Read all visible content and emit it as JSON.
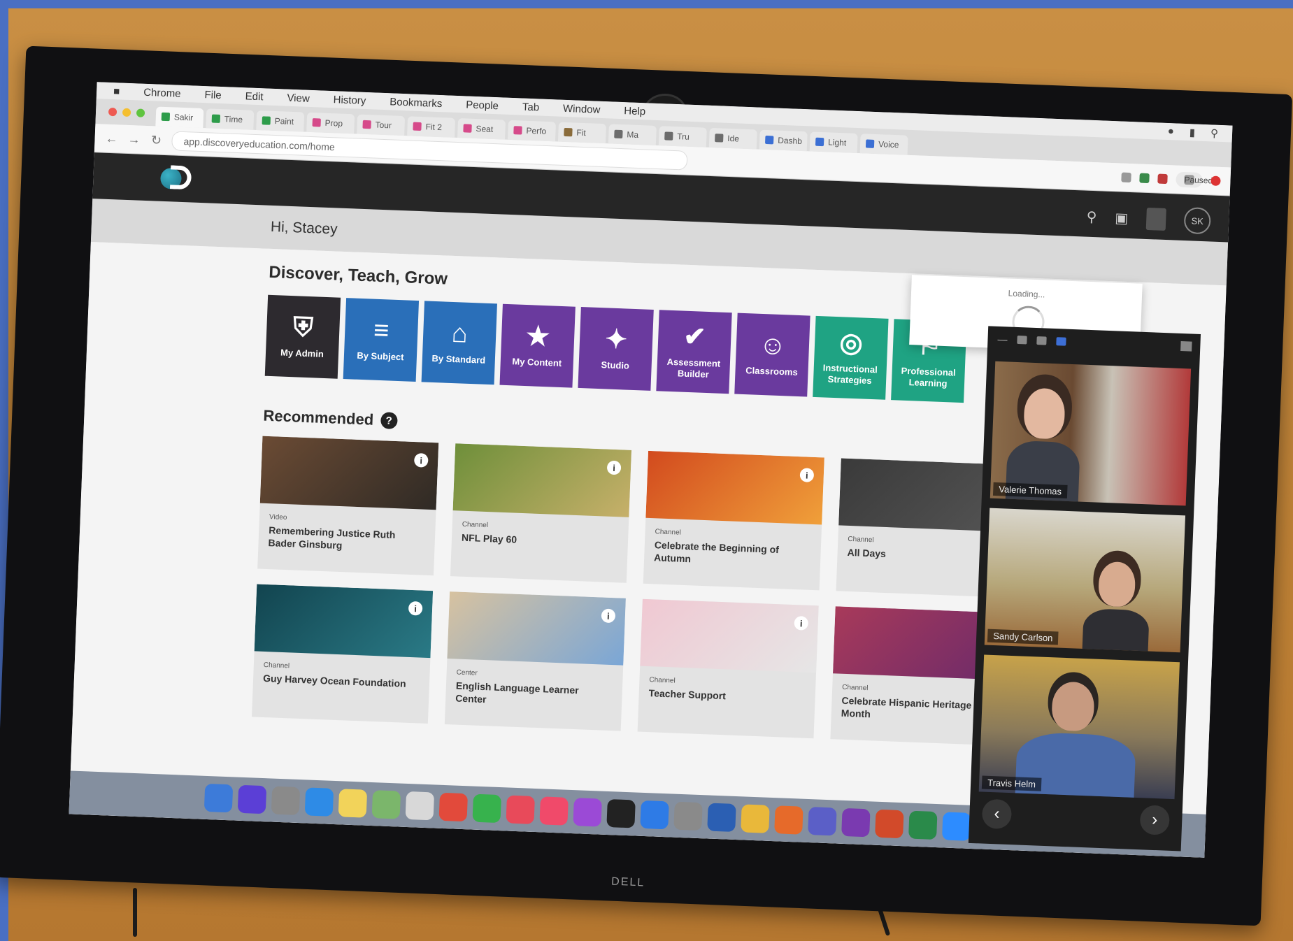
{
  "browser": {
    "menu": [
      "Chrome",
      "File",
      "Edit",
      "View",
      "History",
      "Bookmarks",
      "People",
      "Tab",
      "Window",
      "Help"
    ],
    "tabs": [
      "Sakir",
      "Time",
      "Paint",
      "Prop",
      "Tour",
      "Fit 2",
      "Seat",
      "Perfo",
      "Fit",
      "Ma",
      "Tru",
      "Ide",
      "Dashb",
      "Light",
      "Voice"
    ],
    "url": "app.discoveryeducation.com/home",
    "profile_label": "Paused",
    "colors": {
      "tab_favicons": [
        "#2d9c4a",
        "#2d9c4a",
        "#2d9c4a",
        "#d64a8a",
        "#d64a8a",
        "#d64a8a",
        "#d64a8a",
        "#d64a8a",
        "#8a6b3a",
        "#6c6c6c",
        "#6c6c6c",
        "#6c6c6c",
        "#3b6fd4",
        "#3b6fd4",
        "#3b6fd4"
      ]
    }
  },
  "site": {
    "greeting": "Hi, Stacey",
    "header_icons": [
      "search-icon",
      "notification-icon",
      "avatar"
    ],
    "avatar_initials": "SK",
    "loading_text": "Loading..."
  },
  "discover": {
    "title": "Discover, Teach, Grow",
    "tiles": [
      {
        "label": "My Admin",
        "icon": "shield-gear-icon",
        "color": "#2d2a2f"
      },
      {
        "label": "By Subject",
        "icon": "books-icon",
        "color": "#2a6fb9"
      },
      {
        "label": "By Standard",
        "icon": "mortarboard-icon",
        "color": "#2a6fb9"
      },
      {
        "label": "My Content",
        "icon": "folder-star-icon",
        "color": "#6a3a9e"
      },
      {
        "label": "Studio",
        "icon": "magic-wand-icon",
        "color": "#6a3a9e"
      },
      {
        "label": "Assessment Builder",
        "icon": "hand-check-icon",
        "color": "#6a3a9e"
      },
      {
        "label": "Classrooms",
        "icon": "people-icon",
        "color": "#6a3a9e"
      },
      {
        "label": "Instructional Strategies",
        "icon": "lifebuoy-icon",
        "color": "#1fa383"
      },
      {
        "label": "Professional Learning",
        "icon": "teacher-icon",
        "color": "#1fa383"
      }
    ]
  },
  "recommended": {
    "title": "Recommended",
    "cards": [
      {
        "type": "Video",
        "title": "Remembering Justice Ruth Bader Ginsburg",
        "colors": [
          "#6b4b34",
          "#2f2a25"
        ]
      },
      {
        "type": "Channel",
        "title": "NFL Play 60",
        "colors": [
          "#6e8f3a",
          "#c7b06a"
        ]
      },
      {
        "type": "Channel",
        "title": "Celebrate the Beginning of Autumn",
        "colors": [
          "#d24a1e",
          "#f0a03a"
        ]
      },
      {
        "type": "Channel",
        "title": "All Days",
        "colors": [
          "#3a3a3a",
          "#555555"
        ]
      },
      {
        "type": "Channel",
        "title": "Guy Harvey Ocean Foundation",
        "colors": [
          "#12444f",
          "#2a7a86"
        ]
      },
      {
        "type": "Center",
        "title": "English Language Learner Center",
        "colors": [
          "#d7c2a0",
          "#7aa6d6"
        ]
      },
      {
        "type": "Channel",
        "title": "Teacher Support",
        "colors": [
          "#f0c8d2",
          "#e6e6e6"
        ]
      },
      {
        "type": "Channel",
        "title": "Celebrate Hispanic Heritage Month",
        "colors": [
          "#a83a5a",
          "#6b2a6a"
        ]
      }
    ]
  },
  "dock": {
    "apps": [
      {
        "icon": "finder-icon",
        "color": "#3d7bd9"
      },
      {
        "icon": "siri-icon",
        "color": "#5b3fd6"
      },
      {
        "icon": "launchpad-icon",
        "color": "#8a8a8a"
      },
      {
        "icon": "safari-icon",
        "color": "#2e8be6"
      },
      {
        "icon": "notes-icon",
        "color": "#f2d35a"
      },
      {
        "icon": "photos-icon",
        "color": "#7bb66b"
      },
      {
        "icon": "textedit-icon",
        "color": "#d8d8d8"
      },
      {
        "icon": "chrome-icon",
        "color": "#e24a3b"
      },
      {
        "icon": "messages-icon",
        "color": "#37b24d"
      },
      {
        "icon": "news-icon",
        "color": "#e84a5a"
      },
      {
        "icon": "music-icon",
        "color": "#f04a6a"
      },
      {
        "icon": "podcasts-icon",
        "color": "#9b4ad6"
      },
      {
        "icon": "tv-icon",
        "color": "#222222"
      },
      {
        "icon": "appstore-icon",
        "color": "#2e7be6"
      },
      {
        "icon": "preferences-icon",
        "color": "#8a8a8a"
      },
      {
        "icon": "word-icon",
        "color": "#2b5fb3"
      },
      {
        "icon": "chrome-icon",
        "color": "#e9b83a"
      },
      {
        "icon": "firefox-icon",
        "color": "#e66a2a"
      },
      {
        "icon": "teams-icon",
        "color": "#5b5fc7"
      },
      {
        "icon": "onenote-icon",
        "color": "#7a3ab0"
      },
      {
        "icon": "powerpoint-icon",
        "color": "#d24a2a"
      },
      {
        "icon": "excel-icon",
        "color": "#2a8a4a"
      },
      {
        "icon": "zoom-icon",
        "color": "#2d8cff"
      },
      {
        "icon": "webex-icon",
        "color": "#3a7ad6"
      },
      {
        "icon": "folder-icon",
        "color": "#4aa3d6"
      },
      {
        "icon": "trash-icon",
        "color": "#aaaaaa"
      }
    ]
  },
  "video_call": {
    "participants": [
      {
        "name": "Valerie Thomas"
      },
      {
        "name": "Sandy Carlson"
      },
      {
        "name": "Travis Helm"
      }
    ]
  },
  "hardware": {
    "monitor_brand": "DELL"
  }
}
